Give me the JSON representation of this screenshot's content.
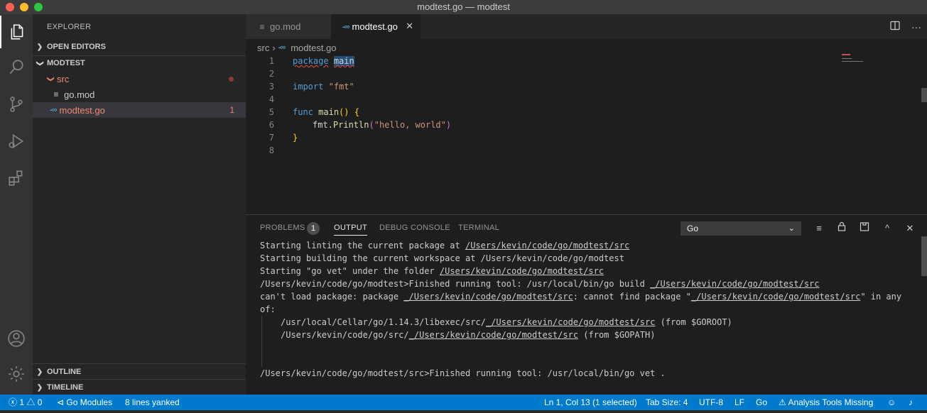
{
  "window": {
    "title": "modtest.go — modtest"
  },
  "activity_bar": {
    "items": [
      "explorer-icon",
      "search-icon",
      "source-control-icon",
      "run-debug-icon",
      "extensions-icon"
    ],
    "bottom": [
      "account-icon",
      "settings-gear-icon"
    ]
  },
  "sidebar": {
    "title": "EXPLORER",
    "open_editors": "OPEN EDITORS",
    "workspace": "MODTEST",
    "folder": "src",
    "files": [
      {
        "name": "go.mod"
      },
      {
        "name": "modtest.go",
        "problems": "1"
      }
    ],
    "outline": "OUTLINE",
    "timeline": "TIMELINE"
  },
  "tabs": [
    {
      "label": "go.mod"
    },
    {
      "label": "modtest.go",
      "close": "✕"
    }
  ],
  "tab_actions": [
    "split-editor-icon",
    "more-actions-icon"
  ],
  "breadcrumb": {
    "folder": "src",
    "separator": "›",
    "file": "modtest.go"
  },
  "editor": {
    "line_numbers": [
      "1",
      "2",
      "3",
      "4",
      "5",
      "6",
      "7",
      "8"
    ],
    "lines": {
      "l1_kw": "package",
      "l1_name": "main",
      "l3_kw": "import",
      "l3_str": "\"fmt\"",
      "l5_kw": "func",
      "l5_fn": "main",
      "l5_parens": "()",
      "l5_brace": "{",
      "l6_pkg": "fmt.",
      "l6_fn": "Println",
      "l6_open": "(",
      "l6_str": "\"hello, world\"",
      "l6_close": ")",
      "l7_brace": "}"
    }
  },
  "panel": {
    "tabs": [
      "PROBLEMS",
      "OUTPUT",
      "DEBUG CONSOLE",
      "TERMINAL"
    ],
    "problems_count": "1",
    "active_tab": "OUTPUT",
    "channel": "Go",
    "actions": [
      "clear-output-icon",
      "lock-scroll-icon",
      "open-log-icon",
      "maximize-panel-icon",
      "close-panel-icon"
    ],
    "output": {
      "l1a": "Starting linting the current package at ",
      "l1b": "/Users/kevin/code/go/modtest/src",
      "l2": "Starting building the current workspace at /Users/kevin/code/go/modtest",
      "l3a": "Starting \"go vet\" under the folder ",
      "l3b": "/Users/kevin/code/go/modtest/src",
      "l4a": "/Users/kevin/code/go/modtest>Finished running tool: /usr/local/bin/go build ",
      "l4b": "_/Users/kevin/code/go/modtest/src",
      "l5a": "can't load package: package ",
      "l5b": "_/Users/kevin/code/go/modtest/src",
      "l5c": ": cannot find package \"",
      "l5d": "_/Users/kevin/code/go/modtest/src",
      "l5e": "\" in any",
      "l6": "of:",
      "l7a": "/usr/local/Cellar/go/1.14.3/libexec/src/",
      "l7b": "_/Users/kevin/code/go/modtest/src",
      "l7c": " (from $GOROOT)",
      "l8a": "/Users/kevin/code/go/src/",
      "l8b": "_/Users/kevin/code/go/modtest/src",
      "l8c": " (from $GOPATH)",
      "l9": "/Users/kevin/code/go/modtest/src>Finished running tool: /usr/local/bin/go vet ."
    }
  },
  "statusbar": {
    "errors": "1",
    "warnings": "0",
    "go_modules": "Go Modules",
    "yanked": "8 lines yanked",
    "position": "Ln 1, Col 13 (1 selected)",
    "tab_size": "Tab Size: 4",
    "encoding": "UTF-8",
    "eol": "LF",
    "language": "Go",
    "analysis": "Analysis Tools Missing"
  },
  "colors": {
    "statusbar": "#007acc",
    "error_text": "#f48771",
    "go_icon": "#519aba"
  }
}
